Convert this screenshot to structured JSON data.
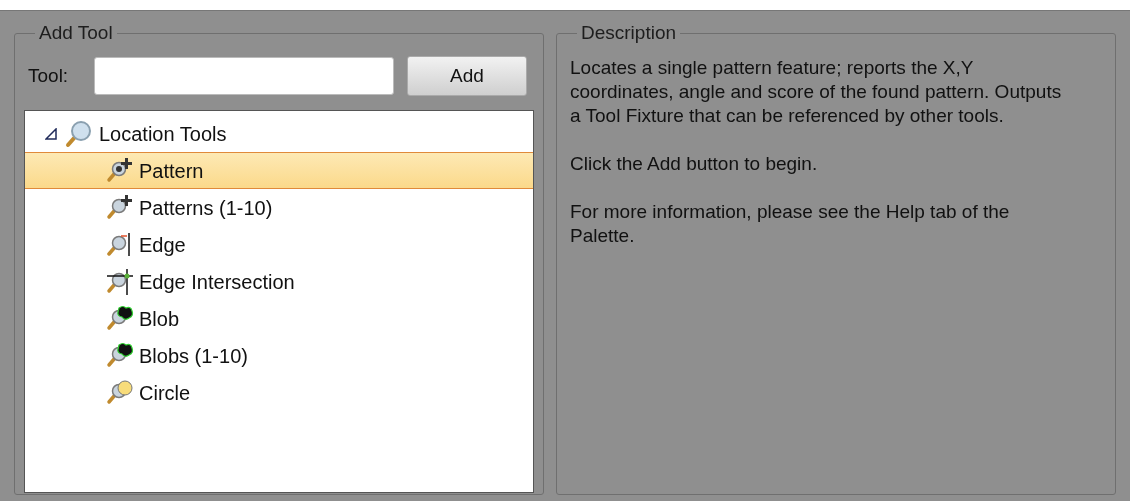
{
  "add_tool": {
    "title": "Add Tool",
    "tool_label": "Tool:",
    "add_button": "Add",
    "tree": [
      {
        "label": "Location Tools",
        "kind": "magnifier",
        "expanded": true,
        "selected": false,
        "children": [
          {
            "label": "Pattern",
            "kind": "pattern",
            "selected": true
          },
          {
            "label": "Patterns (1-10)",
            "kind": "patterns",
            "selected": false
          },
          {
            "label": "Edge",
            "kind": "edge",
            "selected": false
          },
          {
            "label": "Edge Intersection",
            "kind": "edge-intersection",
            "selected": false
          },
          {
            "label": "Blob",
            "kind": "blob",
            "selected": false
          },
          {
            "label": "Blobs (1-10)",
            "kind": "blob",
            "selected": false
          },
          {
            "label": "Circle",
            "kind": "circle",
            "selected": false
          }
        ]
      }
    ]
  },
  "description": {
    "title": "Description",
    "paragraphs": [
      "Locates a single pattern feature; reports the X,Y coordinates, angle and score of the found pattern. Outputs a Tool Fixture that can be referenced by other tools.",
      "Click the Add button to begin.",
      "For more information, please see the Help tab of the Palette."
    ]
  }
}
